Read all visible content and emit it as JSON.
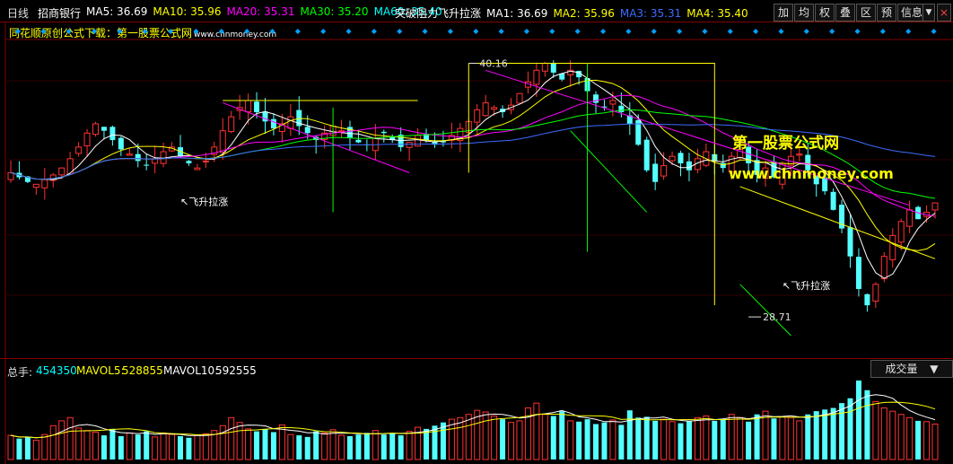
{
  "header": {
    "period": "日线",
    "stock_name": "招商银行",
    "ma_values": [
      {
        "label": "MA5: 36.69",
        "color": "#ffffff"
      },
      {
        "label": "MA10: 35.96",
        "color": "#ffff00"
      },
      {
        "label": "MA20: 35.31",
        "color": "#ff00ff"
      },
      {
        "label": "MA30: 35.20",
        "color": "#00ff00"
      },
      {
        "label": "MA60: 35.40",
        "color": "#00ffff"
      }
    ],
    "indicator_name": "突破阻力飞升拉涨",
    "ind_values": [
      {
        "label": "MA1: 36.69",
        "color": "#ffffff"
      },
      {
        "label": "MA2: 35.96",
        "color": "#ffff00"
      },
      {
        "label": "MA3: 35.31",
        "color": "#3d6bff"
      },
      {
        "label": "MA4: 35.40",
        "color": "#ffff00"
      }
    ],
    "tools": [
      "加",
      "均",
      "权",
      "叠",
      "区",
      "预",
      "信息"
    ],
    "tool_arrow": "▼",
    "close_glyph": "×"
  },
  "subtitle": {
    "text": "同花顺原创公式下载：第一股票公式网",
    "url": "www.chnmoney.com"
  },
  "watermark": {
    "line1": "第一股票公式网",
    "line2": "www.chnmoney.com"
  },
  "annotations": {
    "high_label": "40.16",
    "low_label": "28.71",
    "signal_label": "飞升拉涨"
  },
  "volume_panel": {
    "total": {
      "label": "总手:",
      "value": "454350"
    },
    "mavol5": {
      "label": "MAVOL5:",
      "value": "528855"
    },
    "mavol10": {
      "label": "MAVOL10:",
      "value": "592555"
    },
    "selector_label": "成交量",
    "selector_arrow": "▼"
  },
  "colors": {
    "up": "#ff3232",
    "down": "#54ffff",
    "ma5": "#ffffff",
    "ma10": "#ffff00",
    "ma20": "#ff00ff",
    "ma30": "#00ff00",
    "ma60": "#3d6bff",
    "border": "#800000"
  },
  "chart_data": {
    "type": "candlestick",
    "price_ylim": [
      27.5,
      41.0
    ],
    "high": 40.16,
    "low": 28.71,
    "candles_count": 110,
    "closes": [
      35.2,
      35.0,
      34.8,
      34.7,
      34.9,
      35.1,
      35.4,
      35.8,
      36.3,
      36.9,
      37.3,
      37.0,
      36.6,
      36.2,
      36.0,
      35.7,
      35.5,
      35.8,
      36.1,
      36.3,
      35.9,
      35.6,
      35.4,
      35.7,
      36.3,
      37.0,
      37.6,
      38.0,
      38.3,
      37.8,
      37.4,
      37.1,
      37.3,
      37.6,
      37.2,
      36.9,
      36.6,
      36.9,
      37.2,
      37.0,
      36.7,
      36.5,
      36.4,
      36.7,
      36.9,
      36.6,
      36.3,
      36.5,
      36.8,
      36.6,
      36.4,
      36.5,
      36.8,
      37.1,
      37.4,
      37.9,
      38.2,
      38.0,
      37.8,
      38.1,
      38.6,
      39.1,
      39.6,
      39.9,
      39.5,
      39.2,
      39.6,
      39.3,
      38.7,
      38.2,
      38.0,
      38.3,
      37.8,
      37.3,
      36.4,
      35.3,
      34.8,
      35.5,
      35.9,
      35.6,
      35.3,
      35.8,
      36.1,
      35.7,
      35.4,
      35.9,
      36.2,
      35.6,
      35.1,
      35.4,
      35.0,
      35.6,
      35.9,
      36.0,
      35.3,
      34.7,
      34.4,
      33.6,
      32.8,
      31.6,
      30.2,
      29.5,
      30.4,
      31.6,
      32.5,
      33.1,
      33.6,
      33.2,
      33.5,
      33.9
    ],
    "volumes": [
      300,
      260,
      280,
      240,
      310,
      420,
      480,
      520,
      390,
      360,
      340,
      300,
      380,
      290,
      330,
      310,
      350,
      280,
      330,
      310,
      290,
      270,
      300,
      320,
      360,
      420,
      520,
      460,
      380,
      350,
      380,
      340,
      430,
      310,
      300,
      280,
      350,
      330,
      370,
      300,
      290,
      310,
      330,
      360,
      310,
      320,
      300,
      350,
      400,
      380,
      420,
      460,
      500,
      520,
      560,
      610,
      590,
      540,
      500,
      460,
      480,
      640,
      700,
      560,
      540,
      600,
      480,
      470,
      500,
      440,
      460,
      490,
      430,
      610,
      520,
      530,
      480,
      500,
      470,
      450,
      480,
      520,
      540,
      480,
      500,
      560,
      520,
      470,
      560,
      600,
      510,
      530,
      520,
      480,
      560,
      600,
      620,
      640,
      700,
      760,
      980,
      860,
      720,
      640,
      600,
      560,
      520,
      480,
      470,
      440
    ],
    "annotations": [
      "40.16",
      "28.71",
      "飞升拉涨"
    ],
    "legend": [
      "MA5",
      "MA10",
      "MA20",
      "MA30",
      "MA60"
    ]
  }
}
